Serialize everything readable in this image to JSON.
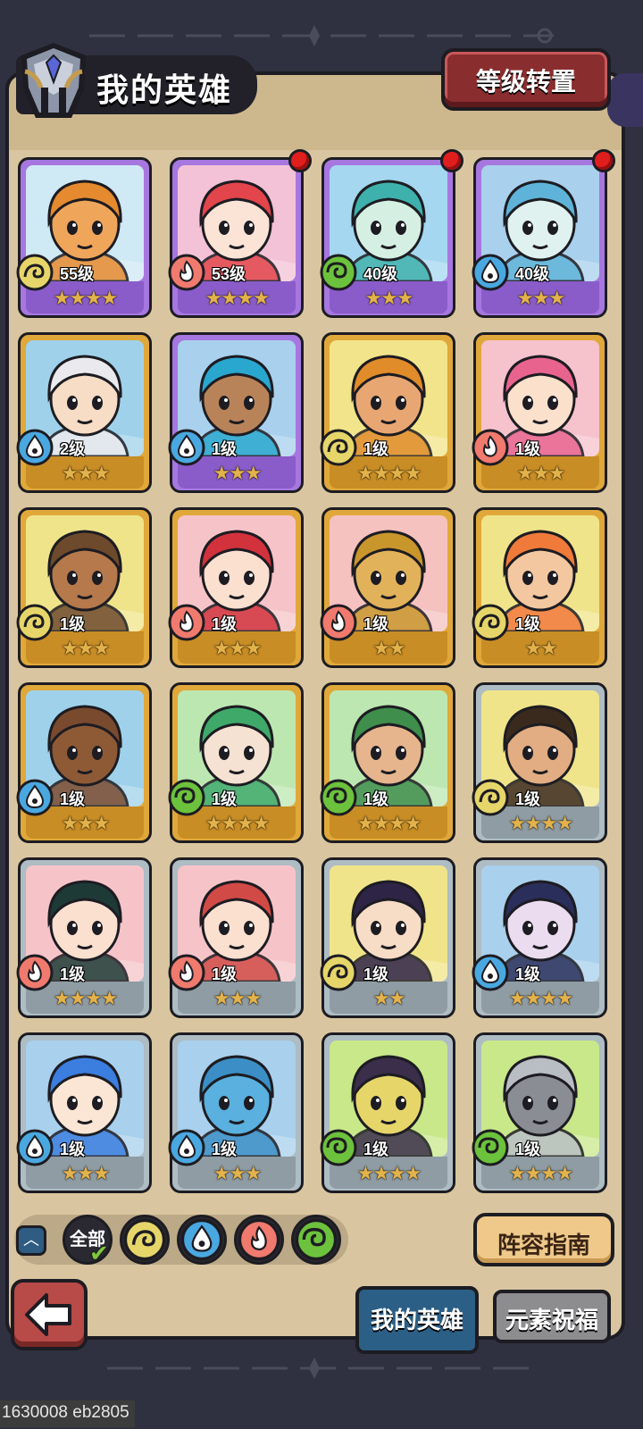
{
  "header": {
    "title": "我的英雄",
    "level_transfer_label": "等级转置"
  },
  "colors": {
    "frame_purple": "#a777e0",
    "frame_gold": "#e0a83a",
    "frame_silver": "#aebcc4",
    "elem_earth": "#e6d66a",
    "elem_fire": "#f07a6e",
    "elem_wind": "#6cc23c",
    "elem_water": "#4aa8e0",
    "active_tab": "#2b5f86"
  },
  "heroes": [
    {
      "level": "55级",
      "element": "earth",
      "stars": "★★★★",
      "rarity": "purple",
      "bg": "#cfe9f5",
      "hair": "#e58a2e",
      "skin": "#f0a65a",
      "dot": false
    },
    {
      "level": "53级",
      "element": "fire",
      "stars": "★★★★",
      "rarity": "purple",
      "bg": "#f3c2d6",
      "hair": "#e2454b",
      "skin": "#fbe3d6",
      "dot": true
    },
    {
      "level": "40级",
      "element": "wind",
      "stars": "★★★",
      "rarity": "purple",
      "bg": "#a5d7f0",
      "hair": "#3fb1ac",
      "skin": "#d5f0e3",
      "dot": true
    },
    {
      "level": "40级",
      "element": "water",
      "stars": "★★★",
      "rarity": "purple",
      "bg": "#a9d0ec",
      "hair": "#5fb3d8",
      "skin": "#dff2ef",
      "dot": true
    },
    {
      "level": "2级",
      "element": "water",
      "stars": "★★★",
      "rarity": "gold",
      "bg": "#9fd2ea",
      "hair": "#eaeaee",
      "skin": "#f7dcc6",
      "dot": false
    },
    {
      "level": "1级",
      "element": "water",
      "stars": "★★★",
      "rarity": "purple",
      "bg": "#a9d0ec",
      "hair": "#2aa7cf",
      "skin": "#b9835a",
      "dot": false
    },
    {
      "level": "1级",
      "element": "earth",
      "stars": "★★★★",
      "rarity": "gold",
      "bg": "#f2e48a",
      "hair": "#e08c2a",
      "skin": "#e8a772",
      "dot": false
    },
    {
      "level": "1级",
      "element": "fire",
      "stars": "★★★",
      "rarity": "gold",
      "bg": "#f6c2cc",
      "hair": "#e8648f",
      "skin": "#fbe0cc",
      "dot": false
    },
    {
      "level": "1级",
      "element": "earth",
      "stars": "★★★",
      "rarity": "gold",
      "bg": "#f0e48a",
      "hair": "#6e4a2c",
      "skin": "#b5794c",
      "dot": false
    },
    {
      "level": "1级",
      "element": "fire",
      "stars": "★★★",
      "rarity": "gold",
      "bg": "#f6c4c8",
      "hair": "#d2323c",
      "skin": "#fbe0d0",
      "dot": false
    },
    {
      "level": "1级",
      "element": "fire",
      "stars": "★★",
      "rarity": "gold",
      "bg": "#f5c2c0",
      "hair": "#c9962c",
      "skin": "#e2b25a",
      "dot": false
    },
    {
      "level": "1级",
      "element": "earth",
      "stars": "★★",
      "rarity": "gold",
      "bg": "#f0e48a",
      "hair": "#f07a3a",
      "skin": "#f3c8a0",
      "dot": false
    },
    {
      "level": "1级",
      "element": "water",
      "stars": "★★★",
      "rarity": "gold",
      "bg": "#9fd2ea",
      "hair": "#7a4a2e",
      "skin": "#8e5a36",
      "dot": false
    },
    {
      "level": "1级",
      "element": "wind",
      "stars": "★★★★",
      "rarity": "gold",
      "bg": "#bde7b0",
      "hair": "#3fa96a",
      "skin": "#f6e2d2",
      "dot": false
    },
    {
      "level": "1级",
      "element": "wind",
      "stars": "★★★★",
      "rarity": "gold",
      "bg": "#bde7b0",
      "hair": "#3f8e4c",
      "skin": "#e6b58e",
      "dot": false
    },
    {
      "level": "1级",
      "element": "earth",
      "stars": "★★★★",
      "rarity": "silver",
      "bg": "#f0e48a",
      "hair": "#3a2a1e",
      "skin": "#e2ad82",
      "dot": false
    },
    {
      "level": "1级",
      "element": "fire",
      "stars": "★★★★",
      "rarity": "silver",
      "bg": "#f6c4c8",
      "hair": "#1e3a36",
      "skin": "#fbe0d0",
      "dot": false
    },
    {
      "level": "1级",
      "element": "fire",
      "stars": "★★★",
      "rarity": "silver",
      "bg": "#f6c4c8",
      "hair": "#d24a46",
      "skin": "#fbe0d0",
      "dot": false
    },
    {
      "level": "1级",
      "element": "earth",
      "stars": "★★",
      "rarity": "silver",
      "bg": "#f0e48a",
      "hair": "#2e2446",
      "skin": "#f7dcc6",
      "dot": false
    },
    {
      "level": "1级",
      "element": "water",
      "stars": "★★★★",
      "rarity": "silver",
      "bg": "#a9d0ec",
      "hair": "#2a2e5a",
      "skin": "#ecdcef",
      "dot": false
    },
    {
      "level": "1级",
      "element": "water",
      "stars": "★★★",
      "rarity": "silver",
      "bg": "#a9d0ec",
      "hair": "#3b7ee0",
      "skin": "#fbe6d6",
      "dot": false
    },
    {
      "level": "1级",
      "element": "water",
      "stars": "★★★",
      "rarity": "silver",
      "bg": "#a9d0ec",
      "hair": "#3b8fc6",
      "skin": "#5ab0de",
      "dot": false
    },
    {
      "level": "1级",
      "element": "wind",
      "stars": "★★★★",
      "rarity": "silver",
      "bg": "#c9e88a",
      "hair": "#3a2e4a",
      "skin": "#e6d66a",
      "dot": false
    },
    {
      "level": "1级",
      "element": "wind",
      "stars": "★★★★",
      "rarity": "silver",
      "bg": "#c9e88a",
      "hair": "#b9bec4",
      "skin": "#8a8e94",
      "dot": false
    }
  ],
  "filters": {
    "collapse_icon": "chevron-up-icon",
    "all_label": "全部",
    "elements": [
      "earth",
      "water",
      "fire",
      "wind"
    ]
  },
  "guide_label": "阵容指南",
  "tabs": {
    "my_heroes": "我的英雄",
    "element_blessing": "元素祝福"
  },
  "build_info": "1630008 eb2805"
}
